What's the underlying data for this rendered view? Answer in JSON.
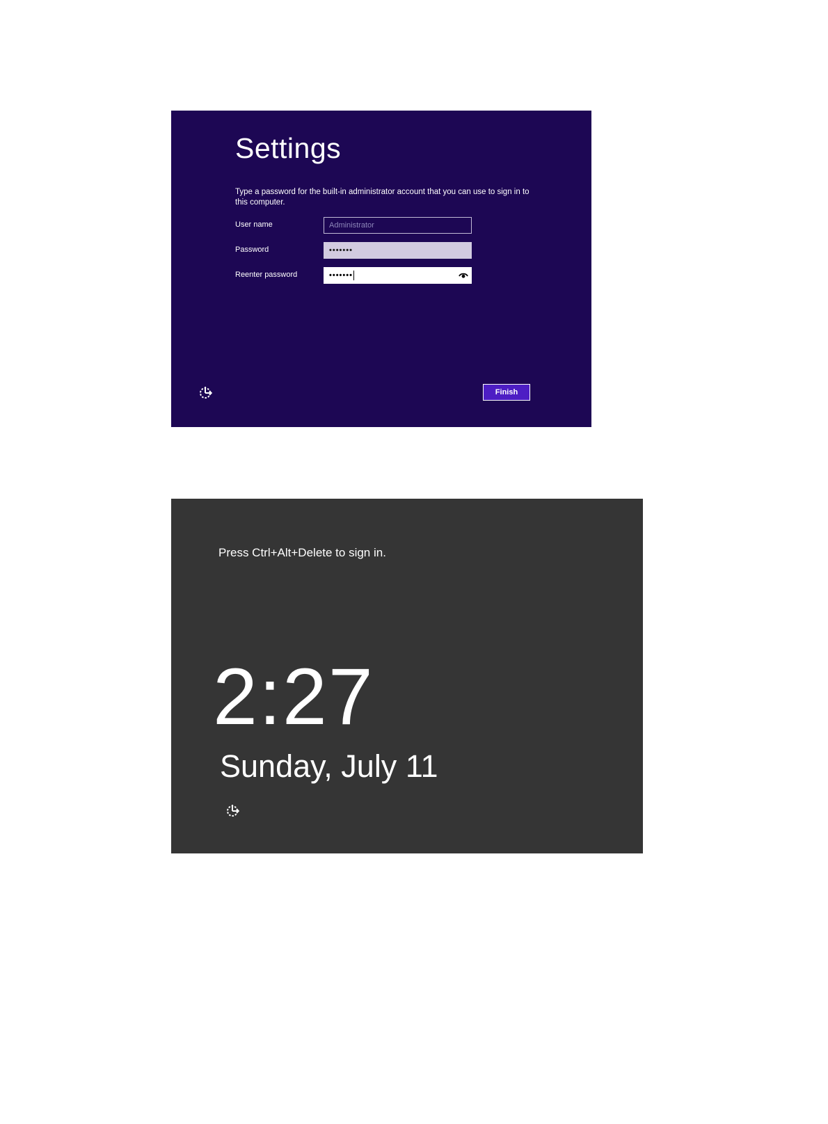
{
  "settings_screen": {
    "title": "Settings",
    "description": "Type a password for the built-in administrator account that you can use to sign in to this computer.",
    "fields": {
      "username": {
        "label": "User name",
        "placeholder": "Administrator"
      },
      "password": {
        "label": "Password",
        "value": "•••••••"
      },
      "reenter": {
        "label": "Reenter password",
        "value": "•••••••"
      }
    },
    "finish_label": "Finish",
    "background_color": "#1d0754",
    "icons": [
      "ease-of-access-icon",
      "reveal-password-eye-icon"
    ]
  },
  "lock_screen": {
    "hint": "Press Ctrl+Alt+Delete to sign in.",
    "time": "2:27",
    "date": "Sunday, July 11",
    "background_color": "#353535",
    "icons": [
      "ease-of-access-icon"
    ]
  }
}
